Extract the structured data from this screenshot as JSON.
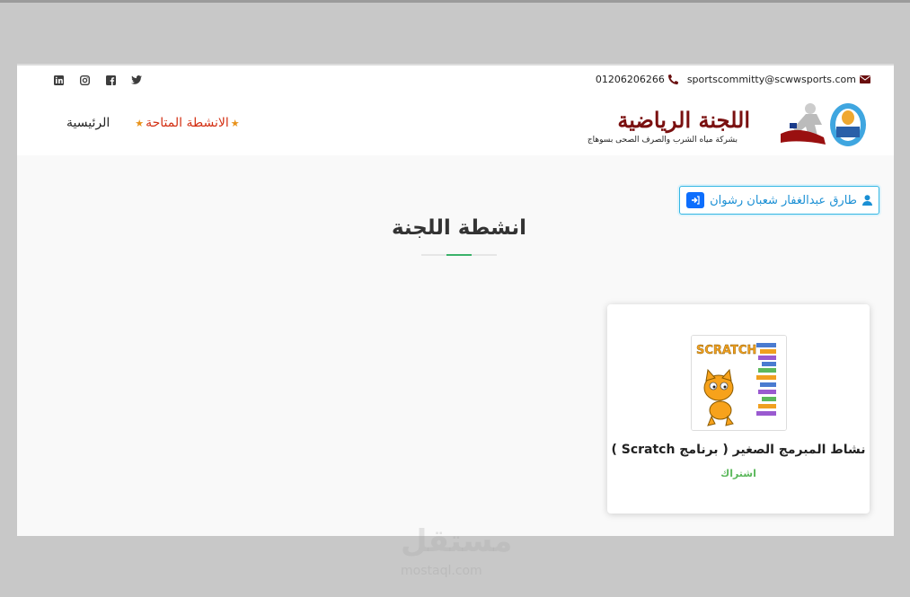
{
  "topbar": {
    "email": "sportscommitty@scwwsports.com",
    "phone": "01206206266",
    "social_icons": [
      "twitter-icon",
      "facebook-icon",
      "instagram-icon",
      "linkedin-icon"
    ]
  },
  "header": {
    "logo_title": "اللجنة الرياضية",
    "logo_subtitle": "بشركة مياه الشرب والصرف الصحى بسوهاج",
    "nav": {
      "home": "الرئيسية",
      "activities": "الانشطة المتاحة"
    }
  },
  "user": {
    "name": "طارق عبدالغفار شعبان رشوان"
  },
  "main": {
    "title": "انشطة اللجنة",
    "cards": [
      {
        "title": "نشاط المبرمج الصغير ( برنامج Scratch )",
        "action": "اشتراك",
        "image_label": "SCRATCH"
      }
    ]
  },
  "watermark": {
    "text": "مستقل",
    "sub": "mostaql.com"
  },
  "colors": {
    "brand": "#7a1010",
    "nav_active": "#d32f12",
    "accent_blue": "#1a8fd4",
    "green": "#5cb85c"
  }
}
